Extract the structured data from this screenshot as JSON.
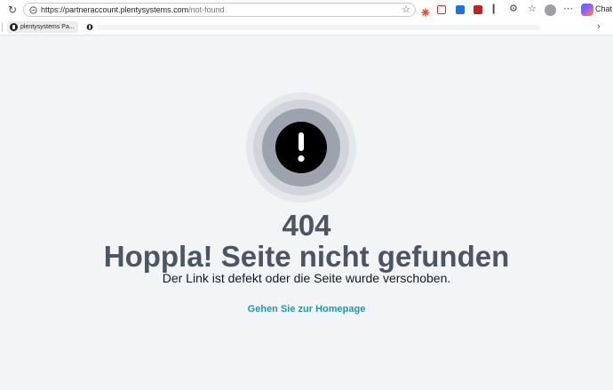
{
  "browser": {
    "url_main": "https://partneraccount.plentysystems.com",
    "url_path": "/not-found",
    "chat_label": "Chat",
    "colors": {
      "ext_1": "#e8452c",
      "ext_2": "#d93025",
      "ext_3": "#1a73e8",
      "ext_4": "#c5221f"
    }
  },
  "bookmarks": {
    "items": [
      {
        "label": "plentysystems Pa...",
        "icon": "plentysystems-logo-icon"
      }
    ]
  },
  "error_page": {
    "code": "404",
    "title": "Hoppla! Seite nicht gefunden",
    "message": "Der Link ist defekt oder die Seite wurde verschoben.",
    "link_label": "Gehen Sie zur Homepage",
    "icon": "exclamation-icon",
    "colors": {
      "heading": "#4b5563",
      "link": "#1b9aaf",
      "background": "#f3f4f6"
    }
  }
}
